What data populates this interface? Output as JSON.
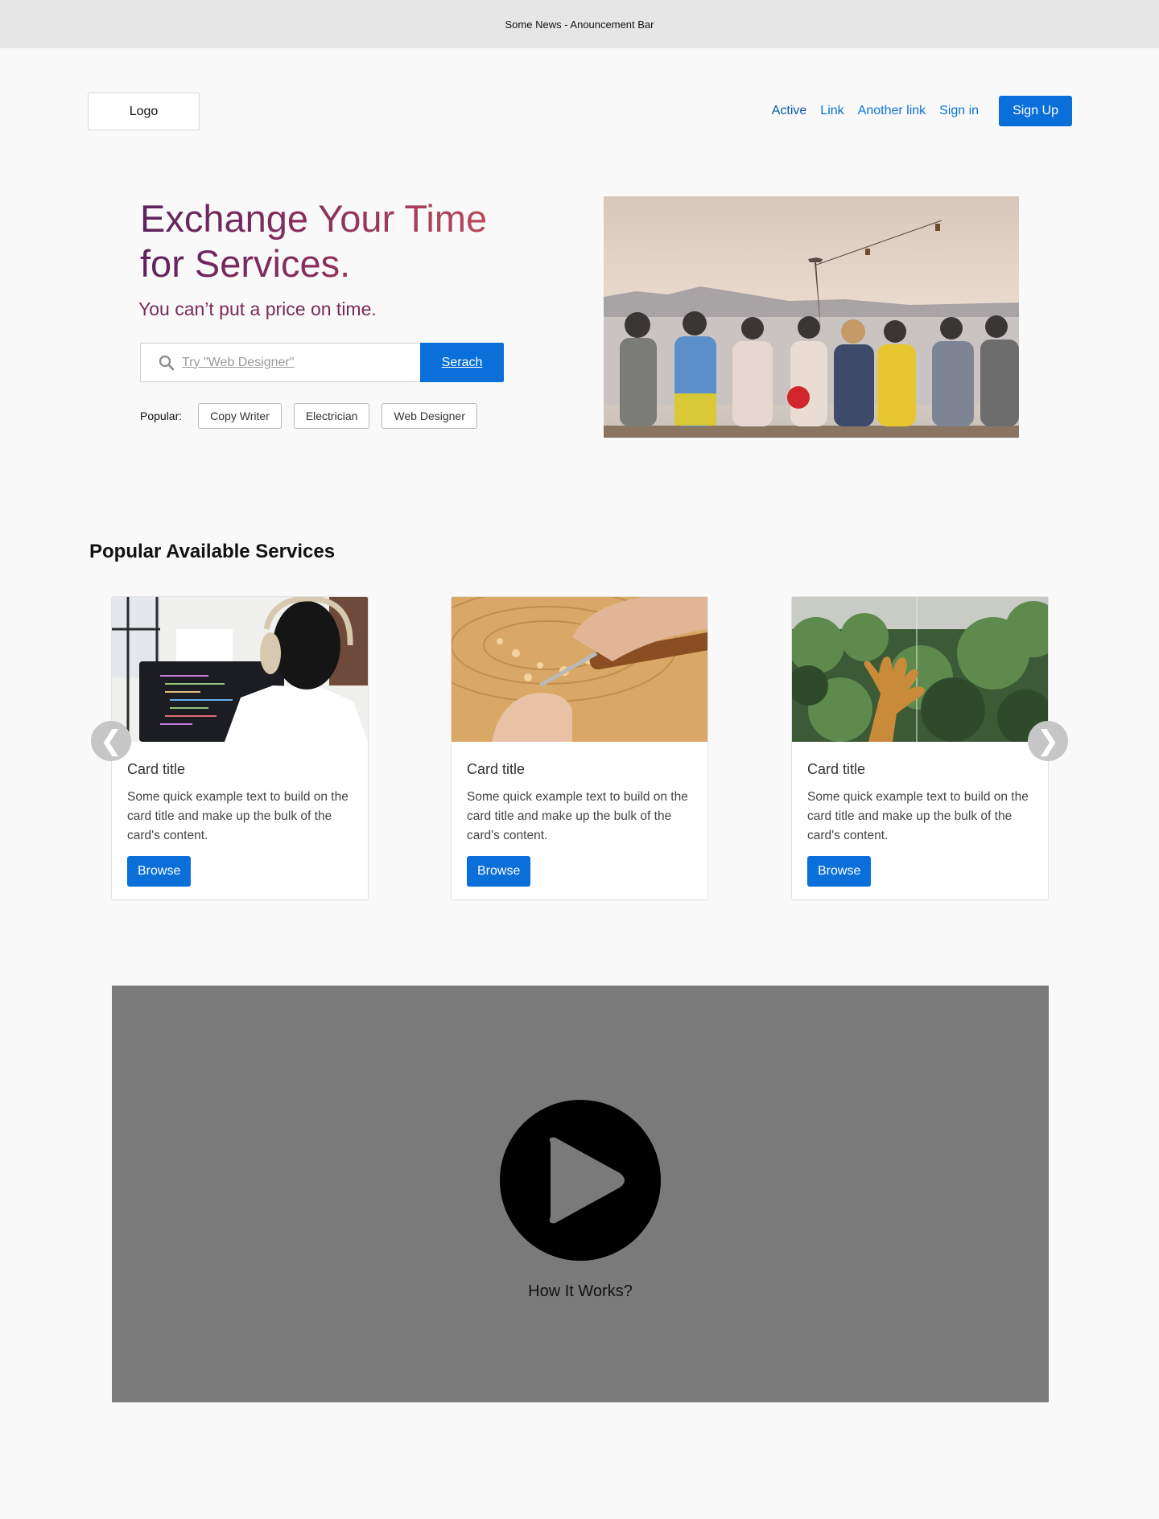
{
  "announcement": {
    "text": "Some News - Anouncement Bar"
  },
  "header": {
    "logo": "Logo",
    "nav": [
      {
        "label": "Active",
        "active": true
      },
      {
        "label": "Link"
      },
      {
        "label": "Another link"
      },
      {
        "label": "Sign in"
      }
    ],
    "signup_label": "Sign Up"
  },
  "hero": {
    "title_line1": "Exchange Your Time",
    "title_line2": "for Services.",
    "subtitle": "You can’t put a price on time.",
    "search": {
      "placeholder": "Try \"Web Designer\"",
      "button": "Serach",
      "icon": "search-icon"
    },
    "popular": {
      "label": "Popular:",
      "tags": [
        "Copy Writer",
        "Electrician",
        "Web Designer"
      ]
    },
    "image_alt": "Group of friends sitting by the sea"
  },
  "services": {
    "title": "Popular Available Services",
    "cards": [
      {
        "title": "Card title",
        "text": "Some quick example text to build on the card title and make up the bulk of the card's content.",
        "button": "Browse"
      },
      {
        "title": "Card title",
        "text": "Some quick example text to build on the card title and make up the bulk of the card's content.",
        "button": "Browse"
      },
      {
        "title": "Card title",
        "text": "Some quick example text to build on the card title and make up the bulk of the card's content.",
        "button": "Browse"
      }
    ],
    "prev_icon": "chevron-left-icon",
    "next_icon": "chevron-right-icon",
    "prev_glyph": "❮",
    "next_glyph": "❯"
  },
  "video": {
    "caption": "How It Works?",
    "icon": "play-icon"
  },
  "colors": {
    "accent": "#0a6fd8",
    "link": "#0a74d6",
    "title_start": "#5e2360",
    "title_end": "#c45057"
  }
}
